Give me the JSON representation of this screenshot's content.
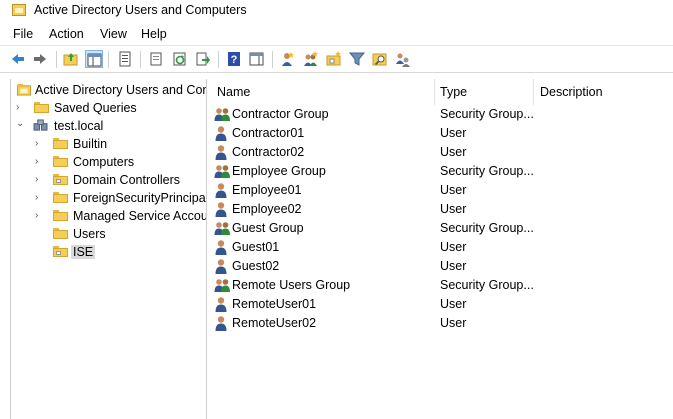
{
  "window": {
    "title": "Active Directory Users and Computers"
  },
  "menu": [
    "File",
    "Action",
    "View",
    "Help"
  ],
  "toolbar": {
    "buttons": [
      {
        "name": "back-icon"
      },
      {
        "name": "forward-icon"
      },
      {
        "name": "up-folder-icon"
      },
      {
        "name": "show-hide-console-tree-icon",
        "active": true
      },
      {
        "name": "properties-icon"
      },
      {
        "name": "copy-icon"
      },
      {
        "name": "refresh-icon"
      },
      {
        "name": "export-list-icon"
      },
      {
        "name": "help-icon"
      },
      {
        "name": "action-pane-icon"
      },
      {
        "name": "new-user-icon"
      },
      {
        "name": "new-group-icon"
      },
      {
        "name": "new-ou-icon"
      },
      {
        "name": "filter-icon"
      },
      {
        "name": "find-icon"
      },
      {
        "name": "add-to-group-icon"
      }
    ]
  },
  "tree": {
    "root": "Active Directory Users and Com",
    "items": [
      {
        "label": "Saved Queries",
        "icon": "folder-icon",
        "arrow": "›"
      },
      {
        "label": "test.local",
        "icon": "domain-icon",
        "arrow": "⌄"
      },
      {
        "label": "Builtin",
        "icon": "folder-icon",
        "arrow": "›"
      },
      {
        "label": "Computers",
        "icon": "folder-icon",
        "arrow": "›"
      },
      {
        "label": "Domain Controllers",
        "icon": "ou-folder-icon",
        "arrow": "›"
      },
      {
        "label": "ForeignSecurityPrincipals",
        "icon": "folder-icon",
        "arrow": "›"
      },
      {
        "label": "Managed Service Accour",
        "icon": "folder-icon",
        "arrow": "›"
      },
      {
        "label": "Users",
        "icon": "folder-icon",
        "arrow": ""
      },
      {
        "label": "ISE",
        "icon": "ou-folder-icon",
        "arrow": "",
        "selected": true
      }
    ]
  },
  "list": {
    "columns": {
      "name": "Name",
      "type": "Type",
      "description": "Description"
    },
    "rows": [
      {
        "name": "Contractor Group",
        "type": "Security Group...",
        "kind": "group"
      },
      {
        "name": "Contractor01",
        "type": "User",
        "kind": "user"
      },
      {
        "name": "Contractor02",
        "type": "User",
        "kind": "user"
      },
      {
        "name": "Employee Group",
        "type": "Security Group...",
        "kind": "group"
      },
      {
        "name": "Employee01",
        "type": "User",
        "kind": "user"
      },
      {
        "name": "Employee02",
        "type": "User",
        "kind": "user"
      },
      {
        "name": "Guest Group",
        "type": "Security Group...",
        "kind": "group"
      },
      {
        "name": "Guest01",
        "type": "User",
        "kind": "user"
      },
      {
        "name": "Guest02",
        "type": "User",
        "kind": "user"
      },
      {
        "name": "Remote Users Group",
        "type": "Security Group...",
        "kind": "group"
      },
      {
        "name": "RemoteUser01",
        "type": "User",
        "kind": "user"
      },
      {
        "name": "RemoteUser02",
        "type": "User",
        "kind": "user"
      }
    ]
  }
}
